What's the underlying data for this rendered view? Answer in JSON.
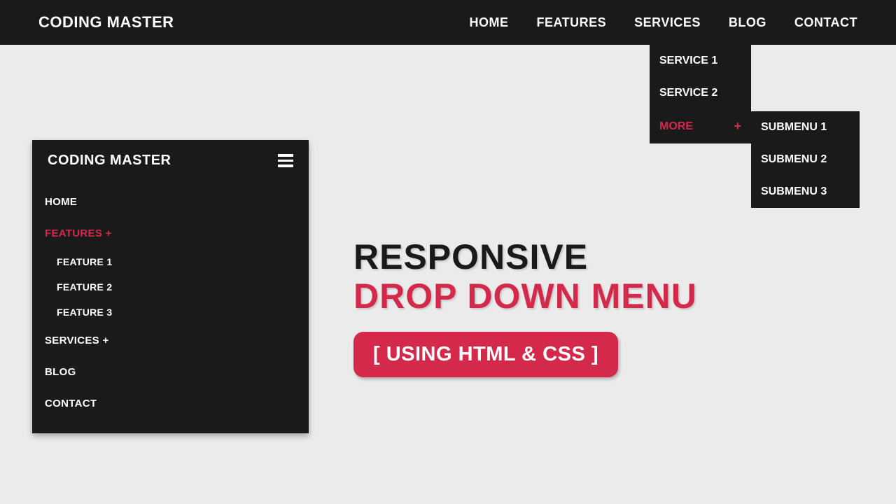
{
  "header": {
    "logo": "CODING MASTER",
    "nav": [
      "HOME",
      "FEATURES",
      "SERVICES",
      "BLOG",
      "CONTACT"
    ]
  },
  "services_dropdown": {
    "items": [
      "SERVICE 1",
      "SERVICE 2"
    ],
    "more_label": "MORE",
    "more_symbol": "+"
  },
  "submenu": [
    "SUBMENU 1",
    "SUBMENU 2",
    "SUBMENU 3"
  ],
  "mobile": {
    "logo": "CODING MASTER",
    "home": "HOME",
    "features": "FEATURES +",
    "feature_items": [
      "FEATURE 1",
      "FEATURE 2",
      "FEATURE 3"
    ],
    "services": "SERVICES +",
    "blog": "BLOG",
    "contact": "CONTACT"
  },
  "hero": {
    "line1": "RESPONSIVE",
    "line2": "DROP DOWN MENU",
    "badge": "[ USING HTML & CSS ]"
  },
  "colors": {
    "accent": "#d4294a",
    "dark": "#1a1a1a",
    "bg": "#ebebeb"
  }
}
